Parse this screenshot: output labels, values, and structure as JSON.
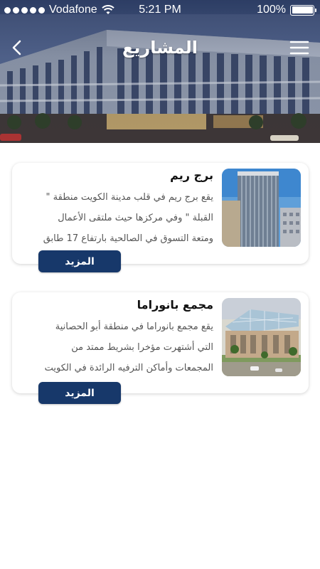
{
  "status_bar": {
    "carrier": "Vodafone",
    "time": "5:21 PM",
    "battery": "100%"
  },
  "header": {
    "title": "المشاريع",
    "back_icon": "chevron-left-icon",
    "menu_icon": "hamburger-menu-icon"
  },
  "projects": [
    {
      "title": "برج ريم",
      "description_lines": [
        "يقع برج ريم في قلب مدينة الكويت منطقة \"",
        "القبلة \" وفي مركزها حيث ملتقى الأعمال",
        "ومتعة التسوق في الصالحية بارتفاع 17 طابق"
      ],
      "button_label": "المزيد"
    },
    {
      "title": "مجمع بانوراما",
      "description_lines": [
        "يقع مجمع بانوراما في منطقة أبو الحصانية",
        "التي أشتهرت مؤخرا بشريط ممتد من",
        "المجمعات وأماكن الترفيه الرائدة في الكويت"
      ],
      "button_label": "المزيد"
    }
  ],
  "colors": {
    "button": "#17386a",
    "title_text": "#111111",
    "desc_text": "#555555"
  }
}
